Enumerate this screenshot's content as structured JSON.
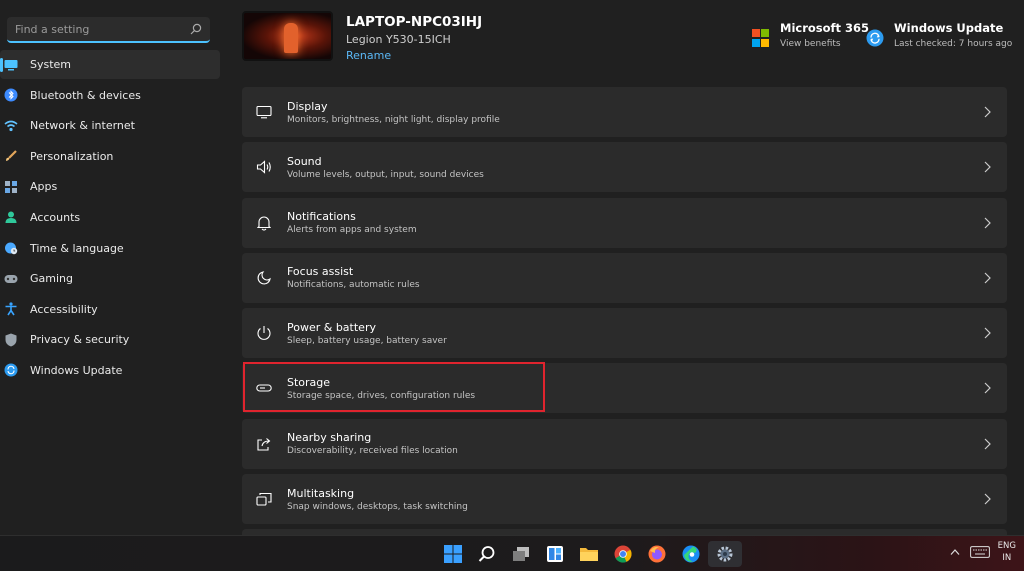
{
  "search": {
    "placeholder": "Find a setting"
  },
  "sidebar": {
    "items": [
      {
        "label": "System",
        "icon": "monitor-icon",
        "color": "#4cc2ff",
        "active": true
      },
      {
        "label": "Bluetooth & devices",
        "icon": "bluetooth-icon",
        "color": "#3d8bff"
      },
      {
        "label": "Network & internet",
        "icon": "wifi-icon",
        "color": "#62c3ff"
      },
      {
        "label": "Personalization",
        "icon": "brush-icon",
        "color": "#e3a55a"
      },
      {
        "label": "Apps",
        "icon": "apps-icon",
        "color": "#9fb3c8"
      },
      {
        "label": "Accounts",
        "icon": "person-icon",
        "color": "#2fc99b"
      },
      {
        "label": "Time & language",
        "icon": "globe-clock-icon",
        "color": "#4aa9ff"
      },
      {
        "label": "Gaming",
        "icon": "gamepad-icon",
        "color": "#9aa4ad"
      },
      {
        "label": "Accessibility",
        "icon": "accessibility-icon",
        "color": "#38a4ff"
      },
      {
        "label": "Privacy & security",
        "icon": "shield-icon",
        "color": "#9aa4ad"
      },
      {
        "label": "Windows Update",
        "icon": "update-icon",
        "color": "#2c9bf0"
      }
    ]
  },
  "device": {
    "name": "LAPTOP-NPC03IHJ",
    "model": "Legion Y530-15ICH",
    "rename": "Rename"
  },
  "header_cards": {
    "ms365": {
      "title": "Microsoft 365",
      "subtitle": "View benefits",
      "icon": "microsoft-logo-icon"
    },
    "update": {
      "title": "Windows Update",
      "subtitle": "Last checked: 7 hours ago",
      "icon": "sync-icon"
    }
  },
  "settings": [
    {
      "title": "Display",
      "subtitle": "Monitors, brightness, night light, display profile",
      "icon": "display-icon"
    },
    {
      "title": "Sound",
      "subtitle": "Volume levels, output, input, sound devices",
      "icon": "speaker-icon"
    },
    {
      "title": "Notifications",
      "subtitle": "Alerts from apps and system",
      "icon": "bell-icon"
    },
    {
      "title": "Focus assist",
      "subtitle": "Notifications, automatic rules",
      "icon": "moon-icon"
    },
    {
      "title": "Power & battery",
      "subtitle": "Sleep, battery usage, battery saver",
      "icon": "power-icon"
    },
    {
      "title": "Storage",
      "subtitle": "Storage space, drives, configuration rules",
      "icon": "storage-icon",
      "highlighted": true
    },
    {
      "title": "Nearby sharing",
      "subtitle": "Discoverability, received files location",
      "icon": "share-icon"
    },
    {
      "title": "Multitasking",
      "subtitle": "Snap windows, desktops, task switching",
      "icon": "multitask-icon"
    },
    {
      "title": "",
      "subtitle": "",
      "icon": ""
    }
  ],
  "highlight_color": "#e0242e",
  "taskbar": {
    "icons": [
      "windows-start-icon",
      "search-icon",
      "task-view-icon",
      "widgets-icon",
      "file-explorer-icon",
      "chrome-icon",
      "firefox-icon",
      "edge-icon",
      "settings-gear-icon"
    ],
    "active": "settings-gear-icon",
    "lang_line1": "ENG",
    "lang_line2": "IN"
  }
}
